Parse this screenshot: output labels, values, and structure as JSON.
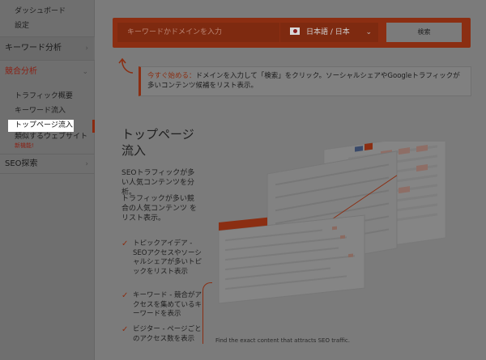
{
  "sidebar": {
    "dashboard": "ダッシュボード",
    "settings": "設定",
    "keyword_analysis": "キーワード分析",
    "competitive_analysis": "競合分析",
    "items": [
      {
        "label": "トラフィック概要"
      },
      {
        "label": "キーワード流入"
      },
      {
        "label": "トップページ流入"
      },
      {
        "label": "類似するウェブサイト"
      }
    ],
    "new_badge": "新機能",
    "new_badge_suffix": "!",
    "seo_explore": "SEO探索"
  },
  "search": {
    "placeholder": "キーワードかドメインを入力",
    "language": "日本語 / 日本",
    "button": "検索"
  },
  "tip": {
    "label": "今すぐ始める：",
    "text": "ドメインを入力して「検索」をクリック。ソーシャルシェアやGoogleトラフィックが多いコンテンツ候補をリスト表示。"
  },
  "main": {
    "heading": "トップページ流入",
    "desc1": "SEOトラフィックが多い人気コンテンツを分析。",
    "desc2": "トラフィックが多い競合の人気コンテンツ をリスト表示。",
    "features": [
      {
        "text": "トピックアイデア - SEOアクセスやソーシャルシェアが多いトピックをリスト表示"
      },
      {
        "text": "キーワード - 競合がアクセスを集めているキーワードを表示"
      },
      {
        "text": "ビジター - ページごとのアクセス数を表示"
      }
    ],
    "caption": "Find the exact content that attracts SEO traffic."
  },
  "colors": {
    "accent": "#8b2e12",
    "overlay_bg": "#7b7b7b",
    "active_item_bg": "#ffffff"
  }
}
